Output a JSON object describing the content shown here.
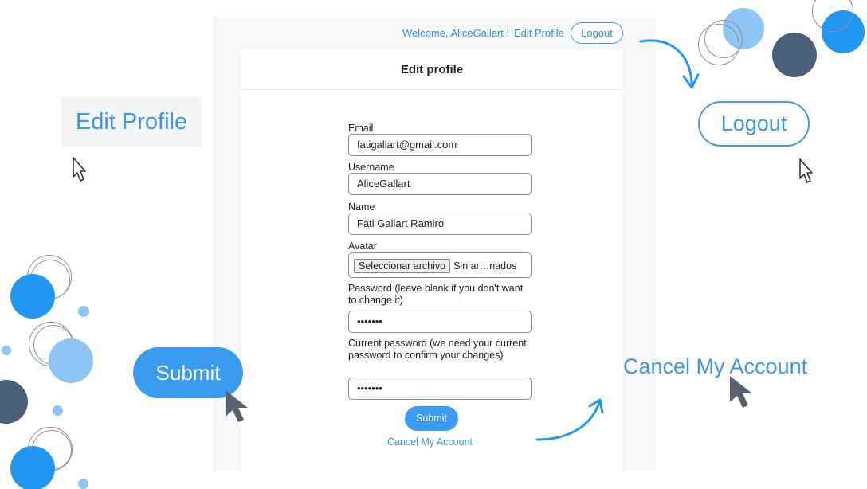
{
  "header": {
    "welcome_text": "Welcome, AliceGallart !",
    "edit_profile_link": "Edit Profile",
    "logout_button": "Logout"
  },
  "page": {
    "title": "Edit profile"
  },
  "form": {
    "email": {
      "label": "Email",
      "value": "fatigallart@gmail.com"
    },
    "username": {
      "label": "Username",
      "value": "AliceGallart"
    },
    "name": {
      "label": "Name",
      "value": "Fati Gallart Ramiro"
    },
    "avatar": {
      "label": "Avatar",
      "button": "Seleccionar archivo",
      "status": "Sin ar…nados"
    },
    "password": {
      "label": "Password (leave blank if you don't want to change it)",
      "value": "•••••••"
    },
    "current_password": {
      "label": "Current password (we need your current password to confirm your changes)",
      "value": "•••••••"
    },
    "submit_button": "Submit",
    "cancel_link": "Cancel My Account"
  },
  "callouts": {
    "edit_profile": "Edit Profile",
    "logout": "Logout",
    "submit": "Submit",
    "cancel": "Cancel My Account"
  },
  "colors": {
    "accent": "#3a9cf0",
    "link": "#3a8fd8",
    "deco_dark": "#4c5f78",
    "deco_light": "#8ec5f5"
  },
  "icons": [
    "pointer-cursor-outline-icon",
    "pointer-cursor-icon",
    "curved-arrow-icon"
  ]
}
